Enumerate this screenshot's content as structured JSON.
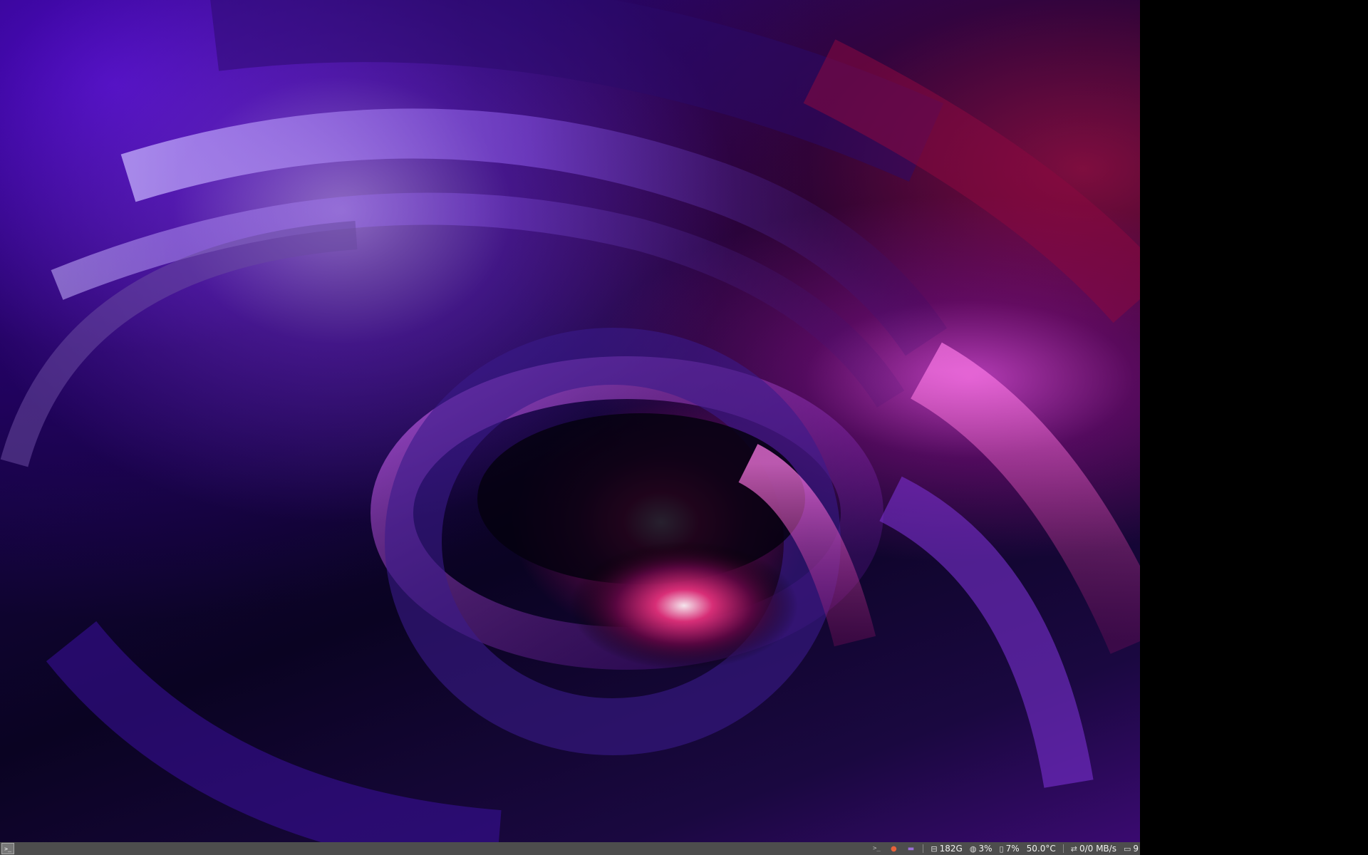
{
  "launcher": {
    "glyph": ">_"
  },
  "tray": {
    "icons": [
      {
        "name": "terminal-icon",
        "glyph": ">_"
      },
      {
        "name": "firefox-icon",
        "glyph": "●"
      },
      {
        "name": "folder-icon",
        "glyph": "▬"
      }
    ],
    "disk": {
      "icon": "drive-icon",
      "value": "182G"
    },
    "cpu": {
      "icon": "gauge-icon",
      "value": "3%"
    },
    "memory": {
      "icon": "memory-icon",
      "value": "7%"
    },
    "temperature": {
      "value": "50.0°C"
    },
    "network": {
      "icon": "transfer-icon",
      "value": "0/0 MB/s"
    },
    "battery": {
      "icon": "battery-icon",
      "value": "9"
    }
  },
  "colors": {
    "taskbar": "#4d4d4d",
    "wallpaper_primary": "#2a0a8a",
    "wallpaper_accent": "#d61e6e"
  }
}
